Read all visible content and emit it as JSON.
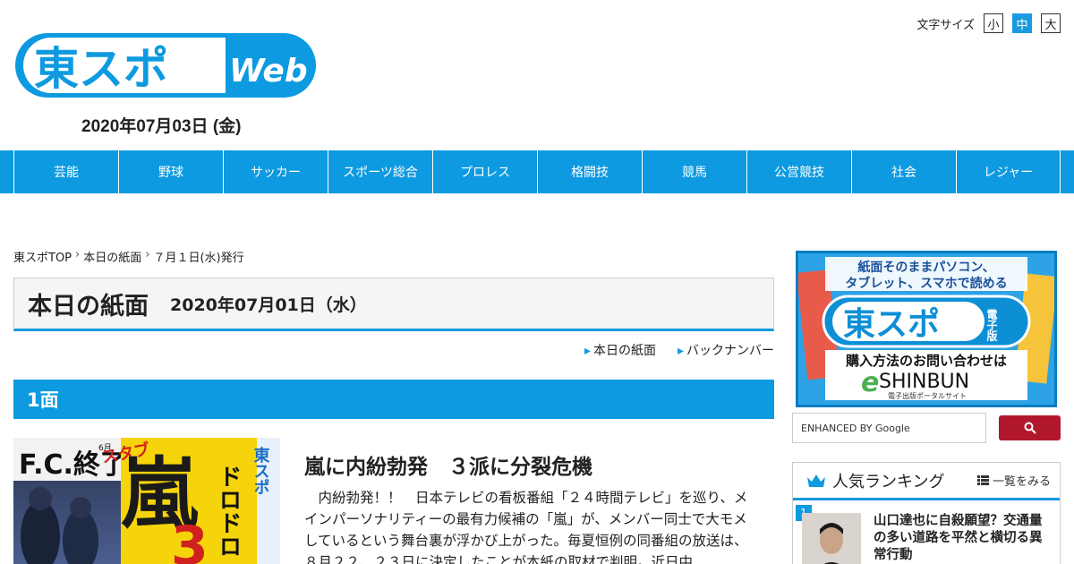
{
  "header": {
    "logo_text": "東スポ",
    "logo_web": "Web",
    "date": "2020年07月03日 (金)",
    "font_size_label": "文字サイズ",
    "font_sizes": [
      "小",
      "中",
      "大"
    ]
  },
  "nav": {
    "items": [
      "芸能",
      "野球",
      "サッカー",
      "スポーツ総合",
      "プロレス",
      "格闘技",
      "競馬",
      "公営競技",
      "社会",
      "レジャー"
    ]
  },
  "breadcrumb": {
    "items": [
      "東スポTOP",
      "本日の紙面",
      "７月１日(水)発行"
    ],
    "separator": "›"
  },
  "page": {
    "title": "本日の紙面",
    "date": "2020年07月01日（水）",
    "sublinks": [
      "本日の紙面",
      "バックナンバー"
    ],
    "section": "1面"
  },
  "article": {
    "title": "嵐に内紛勃発　３派に分裂危機",
    "body": "　内紛勃発！！　日本テレビの看板番組「２４時間テレビ」を巡り、メインパーソナリティーの最有力候補の「嵐」が、メンバー同士で大モメしているという舞台裏が浮かび上がった。毎夏恒例の同番組の放送は、８月２２、２３日に決定したことが本紙の取材で判明。近日中",
    "front_page_texts": {
      "paper": "東スポ",
      "fc": "F.C.終了",
      "month": "6月",
      "headline": "嵐",
      "sub": "ドロドロ",
      "sub2": "スタブ",
      "num": "3"
    }
  },
  "sidebar": {
    "ad": {
      "line1": "紙面そのままパソコン、",
      "line2": "タブレット、スマホで読める",
      "brand": "東スポ",
      "edition": "電子版",
      "line3": "購入方法のお問い合わせは",
      "eshinbun_e": "e",
      "eshinbun": "SHINBUN",
      "portal": "電子出版ポータルサイト"
    },
    "search": {
      "placeholder": "ENHANCED BY Google"
    },
    "ranking": {
      "title": "人気ランキング",
      "all_label": "一覧をみる",
      "items": [
        {
          "rank": "1",
          "text": "山口達也に自殺願望？交通量の多い道路を平然と横切る異常行動"
        }
      ]
    }
  },
  "colors": {
    "accent": "#0d9ae0",
    "search_button": "#b0172c"
  }
}
